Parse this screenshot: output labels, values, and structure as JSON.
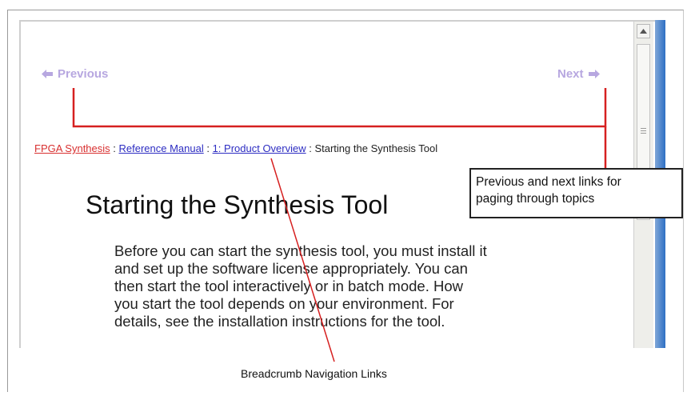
{
  "nav": {
    "previous_label": "Previous",
    "next_label": "Next",
    "previous_icon": "arrow-left-icon",
    "next_icon": "arrow-right-icon"
  },
  "breadcrumb": {
    "items": [
      {
        "label": "FPGA Synthesis",
        "color": "#d83030"
      },
      {
        "label": "Reference Manual",
        "color": "#2d2dc2"
      },
      {
        "label": "1: Product Overview",
        "color": "#2d2dc2"
      }
    ],
    "separator": " : ",
    "current": "Starting the Synthesis Tool"
  },
  "page": {
    "title": "Starting the Synthesis Tool",
    "body_lines": [
      "Before you can start the synthesis tool, you must install it",
      "and set up the software license appropriately. You can",
      "then start the tool interactively or in batch mode. How",
      "you start the tool depends on your environment. For",
      "details, see the installation instructions for the tool."
    ]
  },
  "annotations": {
    "callout_line1": "Previous and next links for",
    "callout_line2": "paging through topics",
    "breadcrumb_caption": "Breadcrumb Navigation Links",
    "line_color": "#d62020"
  },
  "colors": {
    "nav_link": "#b7a7e0",
    "scrollbar_edge": "#2f6fc4"
  }
}
